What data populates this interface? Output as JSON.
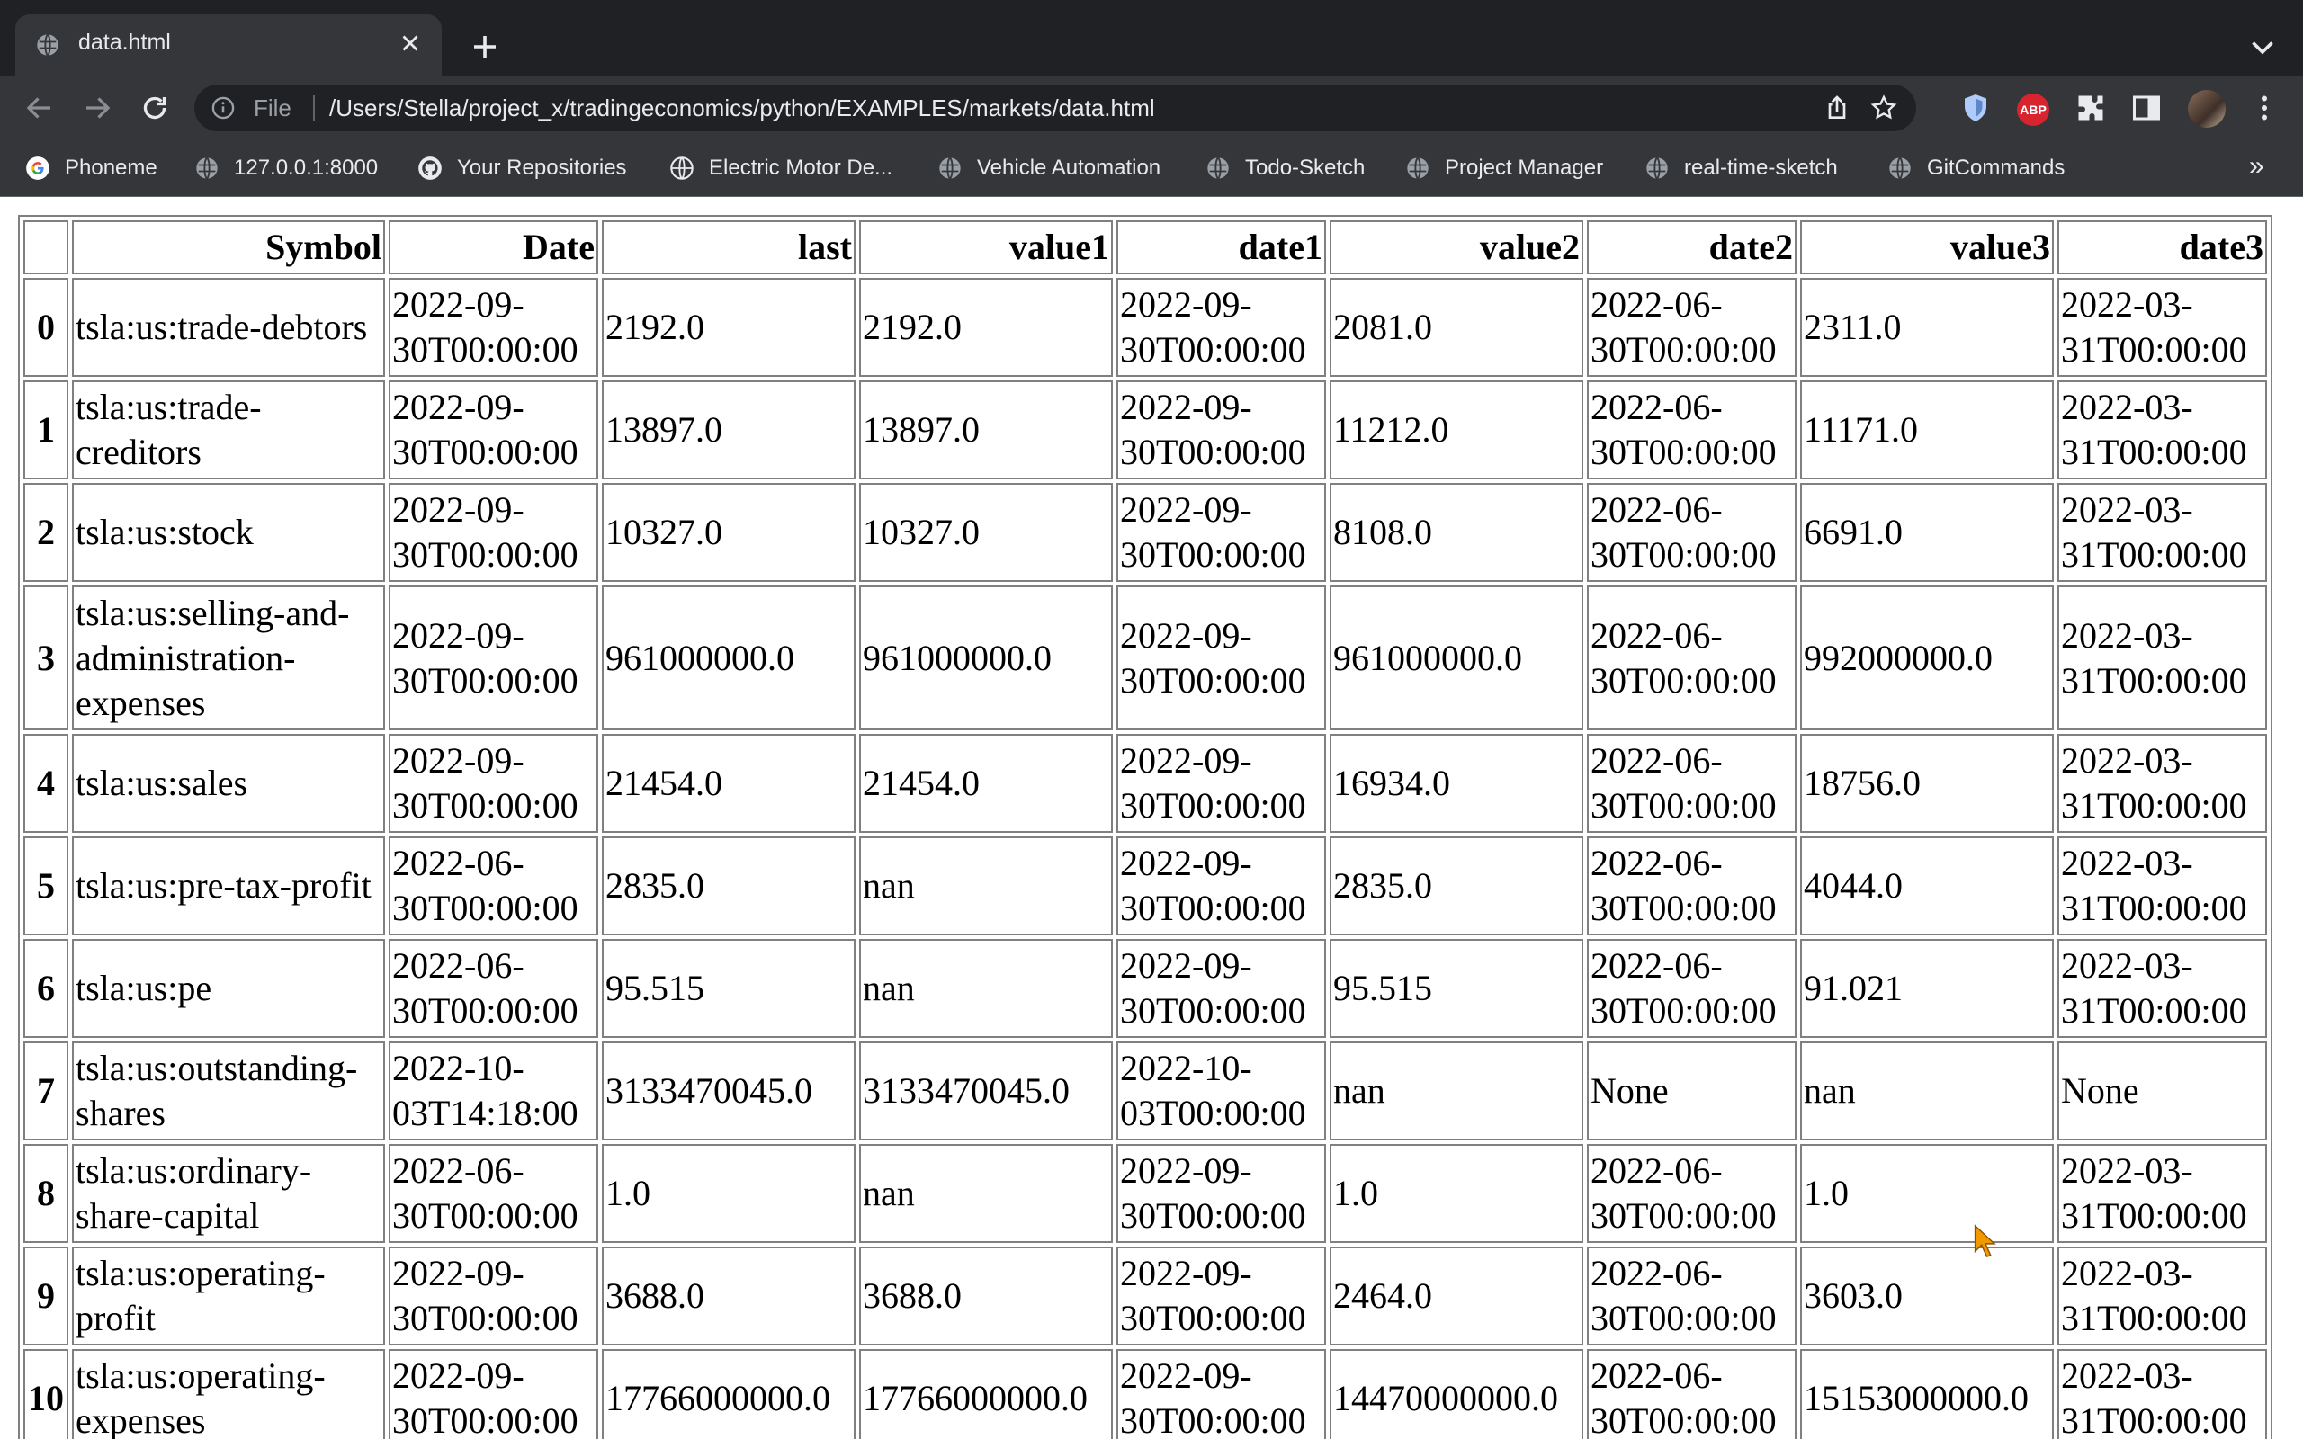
{
  "browser": {
    "tab_title": "data.html",
    "address_scheme": "File",
    "url": "/Users/Stella/project_x/tradingeconomics/python/EXAMPLES/markets/data.html",
    "extension_abp_label": "ABP",
    "bookmarks_overflow": "»",
    "bookmarks": [
      {
        "label": "Phoneme",
        "icon": "google-icon"
      },
      {
        "label": "127.0.0.1:8000",
        "icon": "globe-icon"
      },
      {
        "label": "Your Repositories",
        "icon": "github-icon"
      },
      {
        "label": "Electric Motor De...",
        "icon": "globe-icon"
      },
      {
        "label": "Vehicle Automation",
        "icon": "globe-icon"
      },
      {
        "label": "Todo-Sketch",
        "icon": "globe-icon"
      },
      {
        "label": "Project Manager",
        "icon": "globe-icon"
      },
      {
        "label": "real-time-sketch",
        "icon": "globe-icon"
      },
      {
        "label": "GitCommands",
        "icon": "globe-icon"
      }
    ]
  },
  "table": {
    "columns": [
      "",
      "Symbol",
      "Date",
      "last",
      "value1",
      "date1",
      "value2",
      "date2",
      "value3",
      "date3"
    ],
    "rows": [
      {
        "index": "0",
        "cells": [
          "tsla:us:trade-debtors",
          "2022-09-30T00:00:00",
          "2192.0",
          "2192.0",
          "2022-09-30T00:00:00",
          "2081.0",
          "2022-06-30T00:00:00",
          "2311.0",
          "2022-03-31T00:00:00"
        ]
      },
      {
        "index": "1",
        "cells": [
          "tsla:us:trade-creditors",
          "2022-09-30T00:00:00",
          "13897.0",
          "13897.0",
          "2022-09-30T00:00:00",
          "11212.0",
          "2022-06-30T00:00:00",
          "11171.0",
          "2022-03-31T00:00:00"
        ]
      },
      {
        "index": "2",
        "cells": [
          "tsla:us:stock",
          "2022-09-30T00:00:00",
          "10327.0",
          "10327.0",
          "2022-09-30T00:00:00",
          "8108.0",
          "2022-06-30T00:00:00",
          "6691.0",
          "2022-03-31T00:00:00"
        ]
      },
      {
        "index": "3",
        "cells": [
          "tsla:us:selling-and-administration-expenses",
          "2022-09-30T00:00:00",
          "961000000.0",
          "961000000.0",
          "2022-09-30T00:00:00",
          "961000000.0",
          "2022-06-30T00:00:00",
          "992000000.0",
          "2022-03-31T00:00:00"
        ]
      },
      {
        "index": "4",
        "cells": [
          "tsla:us:sales",
          "2022-09-30T00:00:00",
          "21454.0",
          "21454.0",
          "2022-09-30T00:00:00",
          "16934.0",
          "2022-06-30T00:00:00",
          "18756.0",
          "2022-03-31T00:00:00"
        ]
      },
      {
        "index": "5",
        "cells": [
          "tsla:us:pre-tax-profit",
          "2022-06-30T00:00:00",
          "2835.0",
          "nan",
          "2022-09-30T00:00:00",
          "2835.0",
          "2022-06-30T00:00:00",
          "4044.0",
          "2022-03-31T00:00:00"
        ]
      },
      {
        "index": "6",
        "cells": [
          "tsla:us:pe",
          "2022-06-30T00:00:00",
          "95.515",
          "nan",
          "2022-09-30T00:00:00",
          "95.515",
          "2022-06-30T00:00:00",
          "91.021",
          "2022-03-31T00:00:00"
        ]
      },
      {
        "index": "7",
        "cells": [
          "tsla:us:outstanding-shares",
          "2022-10-03T14:18:00",
          "3133470045.0",
          "3133470045.0",
          "2022-10-03T00:00:00",
          "nan",
          "None",
          "nan",
          "None"
        ]
      },
      {
        "index": "8",
        "cells": [
          "tsla:us:ordinary-share-capital",
          "2022-06-30T00:00:00",
          "1.0",
          "nan",
          "2022-09-30T00:00:00",
          "1.0",
          "2022-06-30T00:00:00",
          "1.0",
          "2022-03-31T00:00:00"
        ]
      },
      {
        "index": "9",
        "cells": [
          "tsla:us:operating-profit",
          "2022-09-30T00:00:00",
          "3688.0",
          "3688.0",
          "2022-09-30T00:00:00",
          "2464.0",
          "2022-06-30T00:00:00",
          "3603.0",
          "2022-03-31T00:00:00"
        ]
      },
      {
        "index": "10",
        "cells": [
          "tsla:us:operating-expenses",
          "2022-09-30T00:00:00",
          "17766000000.0",
          "17766000000.0",
          "2022-09-30T00:00:00",
          "14470000000.0",
          "2022-06-30T00:00:00",
          "15153000000.0",
          "2022-03-31T00:00:00"
        ]
      }
    ]
  }
}
